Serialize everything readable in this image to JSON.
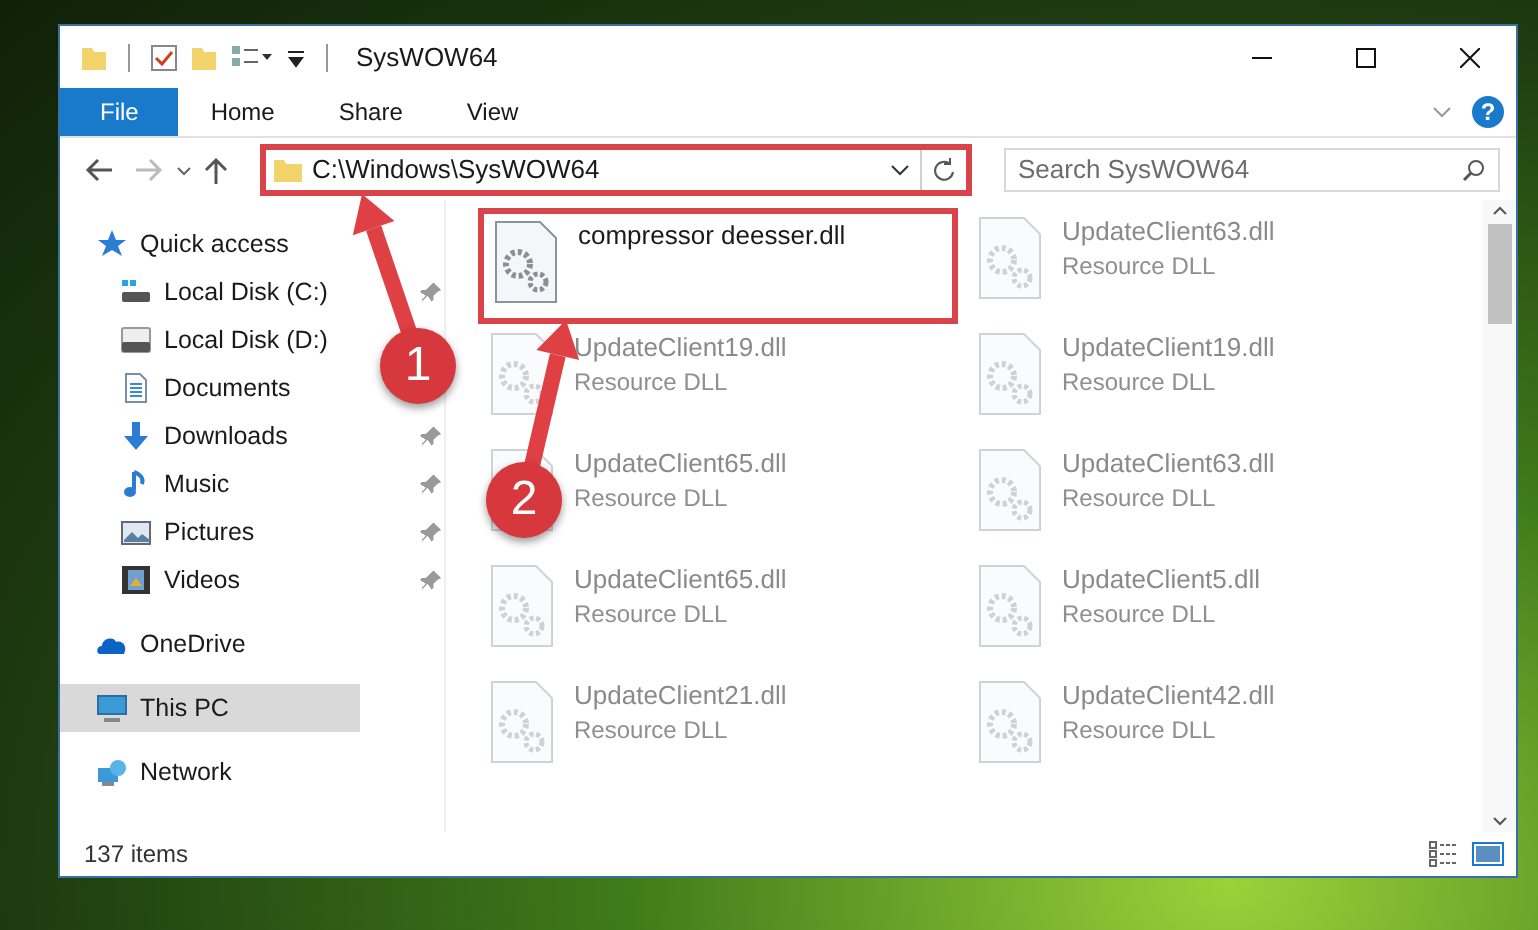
{
  "window": {
    "title": "SysWOW64"
  },
  "ribbon": {
    "tabs": [
      {
        "label": "File",
        "selected": true
      },
      {
        "label": "Home",
        "selected": false
      },
      {
        "label": "Share",
        "selected": false
      },
      {
        "label": "View",
        "selected": false
      }
    ],
    "help": "?"
  },
  "address": {
    "path": "C:\\Windows\\SysWOW64",
    "highlighted": true
  },
  "search": {
    "placeholder": "Search SysWOW64"
  },
  "sidebar": {
    "items": [
      {
        "label": "Quick access",
        "selected": false,
        "children": [
          {
            "label": "Local Disk (C:)",
            "pinned": true,
            "selected": false
          },
          {
            "label": "Local Disk (D:)",
            "pinned": false,
            "selected": false
          },
          {
            "label": "Documents",
            "pinned": false,
            "selected": false
          },
          {
            "label": "Downloads",
            "pinned": true,
            "selected": false
          },
          {
            "label": "Music",
            "pinned": true,
            "selected": false
          },
          {
            "label": "Pictures",
            "pinned": true,
            "selected": false
          },
          {
            "label": "Videos",
            "pinned": true,
            "selected": false
          }
        ]
      },
      {
        "label": "OneDrive",
        "selected": false
      },
      {
        "label": "This PC",
        "selected": true
      },
      {
        "label": "Network",
        "selected": false
      }
    ]
  },
  "files": [
    {
      "name": "compressor deesser.dll",
      "highlighted": true,
      "dimmed": false
    },
    {
      "name": "UpdateClient63.dll",
      "type": "Resource DLL",
      "highlighted": false,
      "dimmed": true
    },
    {
      "name": "UpdateClient19.dll",
      "type": "Resource DLL",
      "highlighted": false,
      "dimmed": true
    },
    {
      "name": "UpdateClient19.dll",
      "type": "Resource DLL",
      "highlighted": false,
      "dimmed": true
    },
    {
      "name": "UpdateClient65.dll",
      "type": "Resource DLL",
      "highlighted": false,
      "dimmed": true
    },
    {
      "name": "UpdateClient63.dll",
      "type": "Resource DLL",
      "highlighted": false,
      "dimmed": true
    },
    {
      "name": "UpdateClient65.dll",
      "type": "Resource DLL",
      "highlighted": false,
      "dimmed": true
    },
    {
      "name": "UpdateClient5.dll",
      "type": "Resource DLL",
      "highlighted": false,
      "dimmed": true
    },
    {
      "name": "UpdateClient21.dll",
      "type": "Resource DLL",
      "highlighted": false,
      "dimmed": true
    },
    {
      "name": "UpdateClient42.dll",
      "type": "Resource DLL",
      "highlighted": false,
      "dimmed": true
    }
  ],
  "status_bar": {
    "count": "137 items"
  },
  "annotations": [
    {
      "number": "1"
    },
    {
      "number": "2"
    }
  ]
}
